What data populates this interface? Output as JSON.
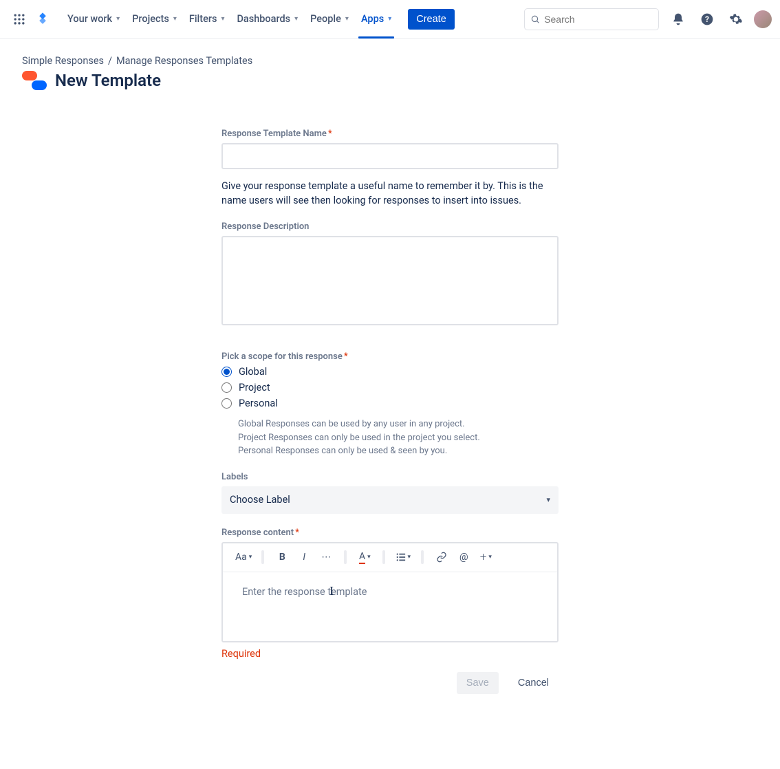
{
  "nav": {
    "items": [
      {
        "label": "Your work"
      },
      {
        "label": "Projects"
      },
      {
        "label": "Filters"
      },
      {
        "label": "Dashboards"
      },
      {
        "label": "People"
      },
      {
        "label": "Apps"
      }
    ],
    "create": "Create",
    "search_placeholder": "Search"
  },
  "breadcrumb": {
    "a": "Simple Responses",
    "b": "Manage Responses Templates"
  },
  "title": "New Template",
  "form": {
    "name_label": "Response Template Name",
    "name_help": "Give your response template a useful name to remember it by. This is the name users will see then looking for responses to insert into issues.",
    "desc_label": "Response Description",
    "scope_label": "Pick a scope for this response",
    "scope_options": [
      "Global",
      "Project",
      "Personal"
    ],
    "scope_selected": "Global",
    "scope_help": [
      "Global Responses can be used by any user in any project.",
      "Project Responses can only be used in the project you select.",
      "Personal Responses can only be used & seen by you."
    ],
    "labels_label": "Labels",
    "labels_placeholder": "Choose Label",
    "content_label": "Response content",
    "content_placeholder": "Enter the response template",
    "required": "Required",
    "save": "Save",
    "cancel": "Cancel"
  }
}
